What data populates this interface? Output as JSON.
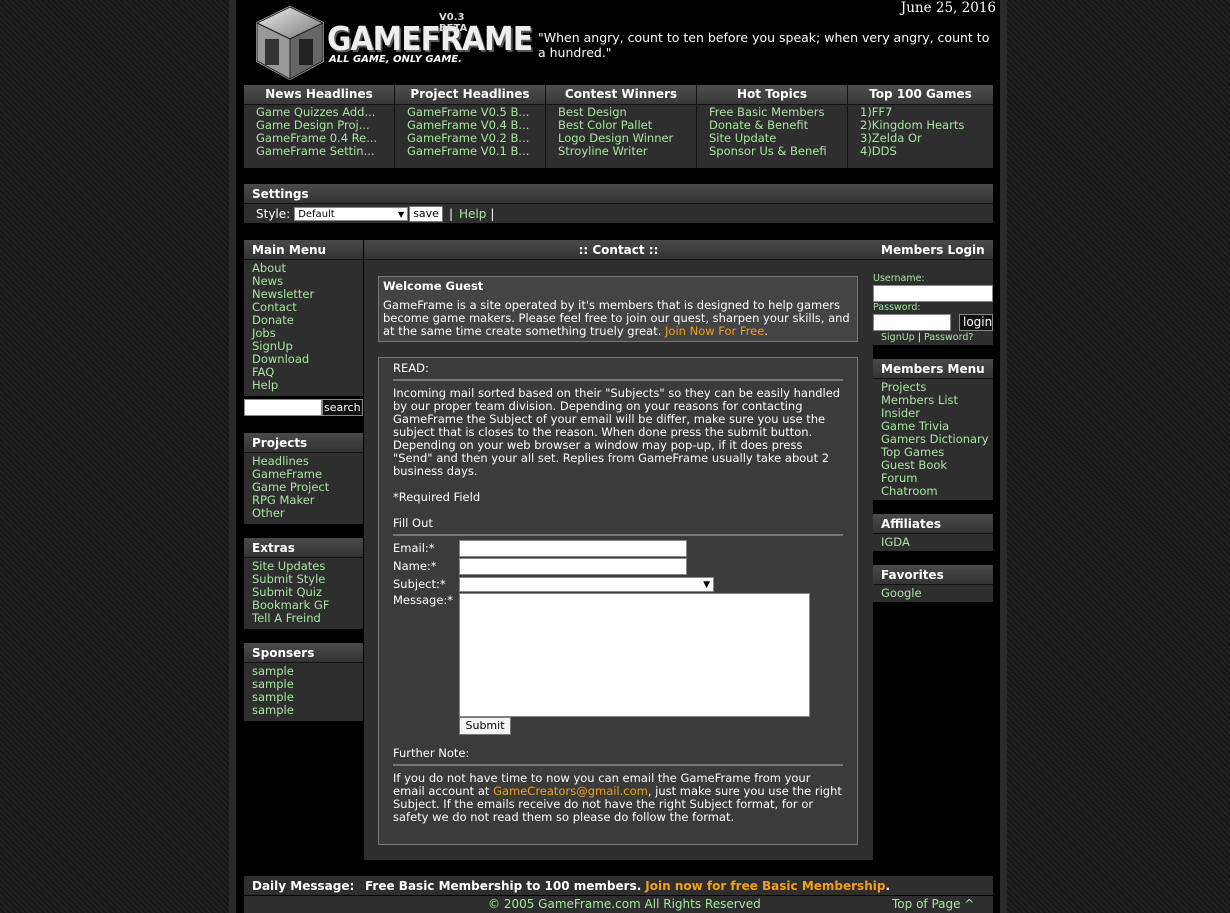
{
  "header": {
    "logo_text": "GAMEFRAME",
    "logo_version": "V0.3 BETA",
    "logo_tagline": "ALL GAME, ONLY GAME.",
    "date": "June 25, 2016",
    "quote": "\"When angry, count to ten before you speak; when very angry, count to a hundred.\""
  },
  "nav": {
    "columns": [
      {
        "title": "News Headlines",
        "items": [
          "Game Quizzes Add...",
          "Game Design Proj...",
          "GameFrame 0.4 Re...",
          "GameFrame Settin..."
        ]
      },
      {
        "title": "Project Headlines",
        "items": [
          "GameFrame V0.5 B...",
          "GameFrame V0.4 B...",
          "GameFrame V0.2 B...",
          "GameFrame V0.1 B..."
        ]
      },
      {
        "title": "Contest Winners",
        "items": [
          "Best Design",
          "Best Color Pallet",
          "Logo Design Winner",
          "Stroyline Writer"
        ]
      },
      {
        "title": "Hot Topics",
        "items": [
          "Free Basic Members",
          "Donate & Benefit",
          "Site Update",
          "Sponsor Us & Benefi"
        ]
      },
      {
        "title": "Top 100 Games",
        "items": [
          "1)FF7",
          "2)Kingdom Hearts",
          "3)Zelda Or",
          "4)DDS"
        ]
      }
    ]
  },
  "settings": {
    "title": "Settings",
    "style_label": "Style:",
    "style_value": "Default",
    "save_label": "save",
    "sep1": "|",
    "help_label": "Help",
    "sep2": "|"
  },
  "left": {
    "main_menu": {
      "title": "Main Menu",
      "items": [
        "About",
        "News",
        "Newsletter",
        "Contact",
        "Donate",
        "Jobs",
        "SignUp",
        "Download",
        "FAQ",
        "Help"
      ]
    },
    "search_button": "search",
    "projects": {
      "title": "Projects",
      "items": [
        "Headlines",
        "GameFrame",
        "Game Project",
        "RPG Maker",
        "Other"
      ]
    },
    "extras": {
      "title": "Extras",
      "items": [
        "Site Updates",
        "Submit Style",
        "Submit Quiz",
        "Bookmark GF",
        "Tell A Freind"
      ]
    },
    "sponsers": {
      "title": "Sponsers",
      "items": [
        "sample",
        "sample",
        "sample",
        "sample"
      ]
    }
  },
  "center": {
    "title": ":: Contact ::",
    "welcome_title": "Welcome Guest",
    "welcome_text": "GameFrame is a site operated by it's members that is designed to help gamers become game makers. Please feel free to join our quest, sharpen your skills, and at the same time create something truely great.",
    "welcome_link": "Join Now For Free",
    "read_label": "READ:",
    "read_text": "Incoming mail sorted based on their \"Subjects\" so they can be easily handled by our proper team division. Depending on your reasons for contacting GameFrame the Subject of your email will be differ, make sure you use the subject that is closes to the reason. When done press the submit button. Depending on your web browser a window may pop-up, if it does press \"Send\" and then your all set. Replies from GameFrame usually take about 2 business days.",
    "required_note": "*Required Field",
    "fill_out": "Fill Out",
    "email_label": "Email:*",
    "name_label": "Name:*",
    "subject_label": "Subject:*",
    "message_label": "Message:*",
    "submit_label": "Submit",
    "further_label": "Further Note:",
    "further_text_1": "If you do not have time to now you can email the GameFrame from your email account at",
    "further_email": "GameCreators@gmail.com",
    "further_text_2": ", just make sure you use the right Subject. If the emails receive do not have the right Subject format, for or safety we do not read them so please do follow the format."
  },
  "right": {
    "login": {
      "title": "Members Login",
      "username_label": "Username:",
      "password_label": "Password:",
      "login_button": "login",
      "signup": "SignUp",
      "sep": "|",
      "password_link": "Password?"
    },
    "members_menu": {
      "title": "Members Menu",
      "items": [
        "Projects",
        "Members List",
        "Insider",
        "Game Trivia",
        "Gamers Dictionary",
        "Top Games",
        "Guest Book",
        "Forum",
        "Chatroom"
      ]
    },
    "affiliates": {
      "title": "Affiliates",
      "items": [
        "IGDA"
      ]
    },
    "favorites": {
      "title": "Favorites",
      "items": [
        "Google"
      ]
    }
  },
  "footer": {
    "daily_label": "Daily Message:",
    "daily_text": "Free Basic Membership to 100 members.",
    "daily_link": "Join now for free Basic Membership",
    "daily_end": ".",
    "copyright": "© 2005 GameFrame.com All Rights Reserved",
    "top_link": "Top of Page ^"
  }
}
